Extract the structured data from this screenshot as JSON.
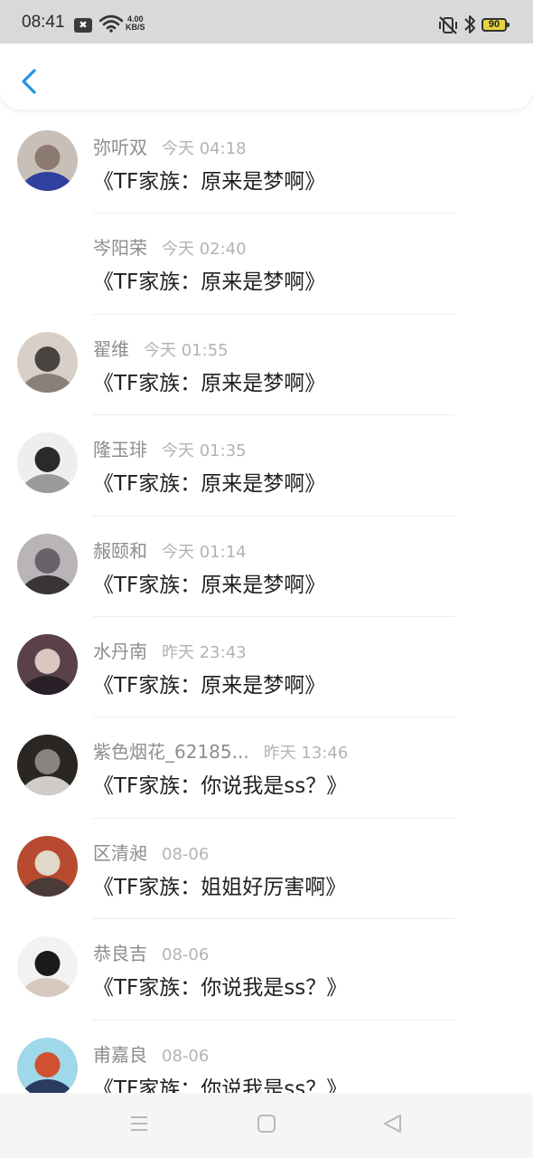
{
  "status_bar": {
    "time": "08:41",
    "notification_glyph": "✖",
    "net_speed_value": "4.00",
    "net_speed_unit": "KB/S",
    "battery": "90"
  },
  "colors": {
    "back_arrow": "#1e96e0",
    "battery_fill": "#e8d23c"
  },
  "items": [
    {
      "name": "弥听双",
      "time": "今天 04:18",
      "message": "《TF家族：原来是梦啊》",
      "avatar_colors": [
        "#c8c0b8",
        "#8a7a70",
        "#3040a0"
      ]
    },
    {
      "name": "岑阳荣",
      "time": "今天 02:40",
      "message": "《TF家族：原来是梦啊》",
      "avatar_colors": [
        "#ffffff",
        "#ffffff",
        "#ffffff"
      ]
    },
    {
      "name": "翟维",
      "time": "今天 01:55",
      "message": "《TF家族：原来是梦啊》",
      "avatar_colors": [
        "#d8d0c8",
        "#4a4440",
        "#8a8078"
      ]
    },
    {
      "name": "隆玉琲",
      "time": "今天 01:35",
      "message": "《TF家族：原来是梦啊》",
      "avatar_colors": [
        "#eeeeee",
        "#2a2a2a",
        "#9a9a9a"
      ]
    },
    {
      "name": "赧颐和",
      "time": "今天 01:14",
      "message": "《TF家族：原来是梦啊》",
      "avatar_colors": [
        "#b8b4b8",
        "#6a6068",
        "#3a3438"
      ]
    },
    {
      "name": "水丹南",
      "time": "昨天 23:43",
      "message": "《TF家族：原来是梦啊》",
      "avatar_colors": [
        "#5a4048",
        "#d8c8c0",
        "#2a2028"
      ]
    },
    {
      "name": "紫色烟花_62185...",
      "time": "昨天 13:46",
      "message": "《TF家族：你说我是ss？》",
      "avatar_colors": [
        "#2a2624",
        "#8a8480",
        "#d0ccc8"
      ]
    },
    {
      "name": "区清昶",
      "time": "08-06",
      "message": "《TF家族：姐姐好厉害啊》",
      "avatar_colors": [
        "#b84a30",
        "#e0d8c8",
        "#4a3a38"
      ]
    },
    {
      "name": "恭良吉",
      "time": "08-06",
      "message": "《TF家族：你说我是ss？》",
      "avatar_colors": [
        "#f2f2f2",
        "#1a1a1a",
        "#d8c8c0"
      ]
    },
    {
      "name": "甫嘉良",
      "time": "08-06",
      "message": "《TF家族：你说我是ss？》",
      "avatar_colors": [
        "#9fd8e8",
        "#d05030",
        "#2a3a60"
      ]
    }
  ]
}
